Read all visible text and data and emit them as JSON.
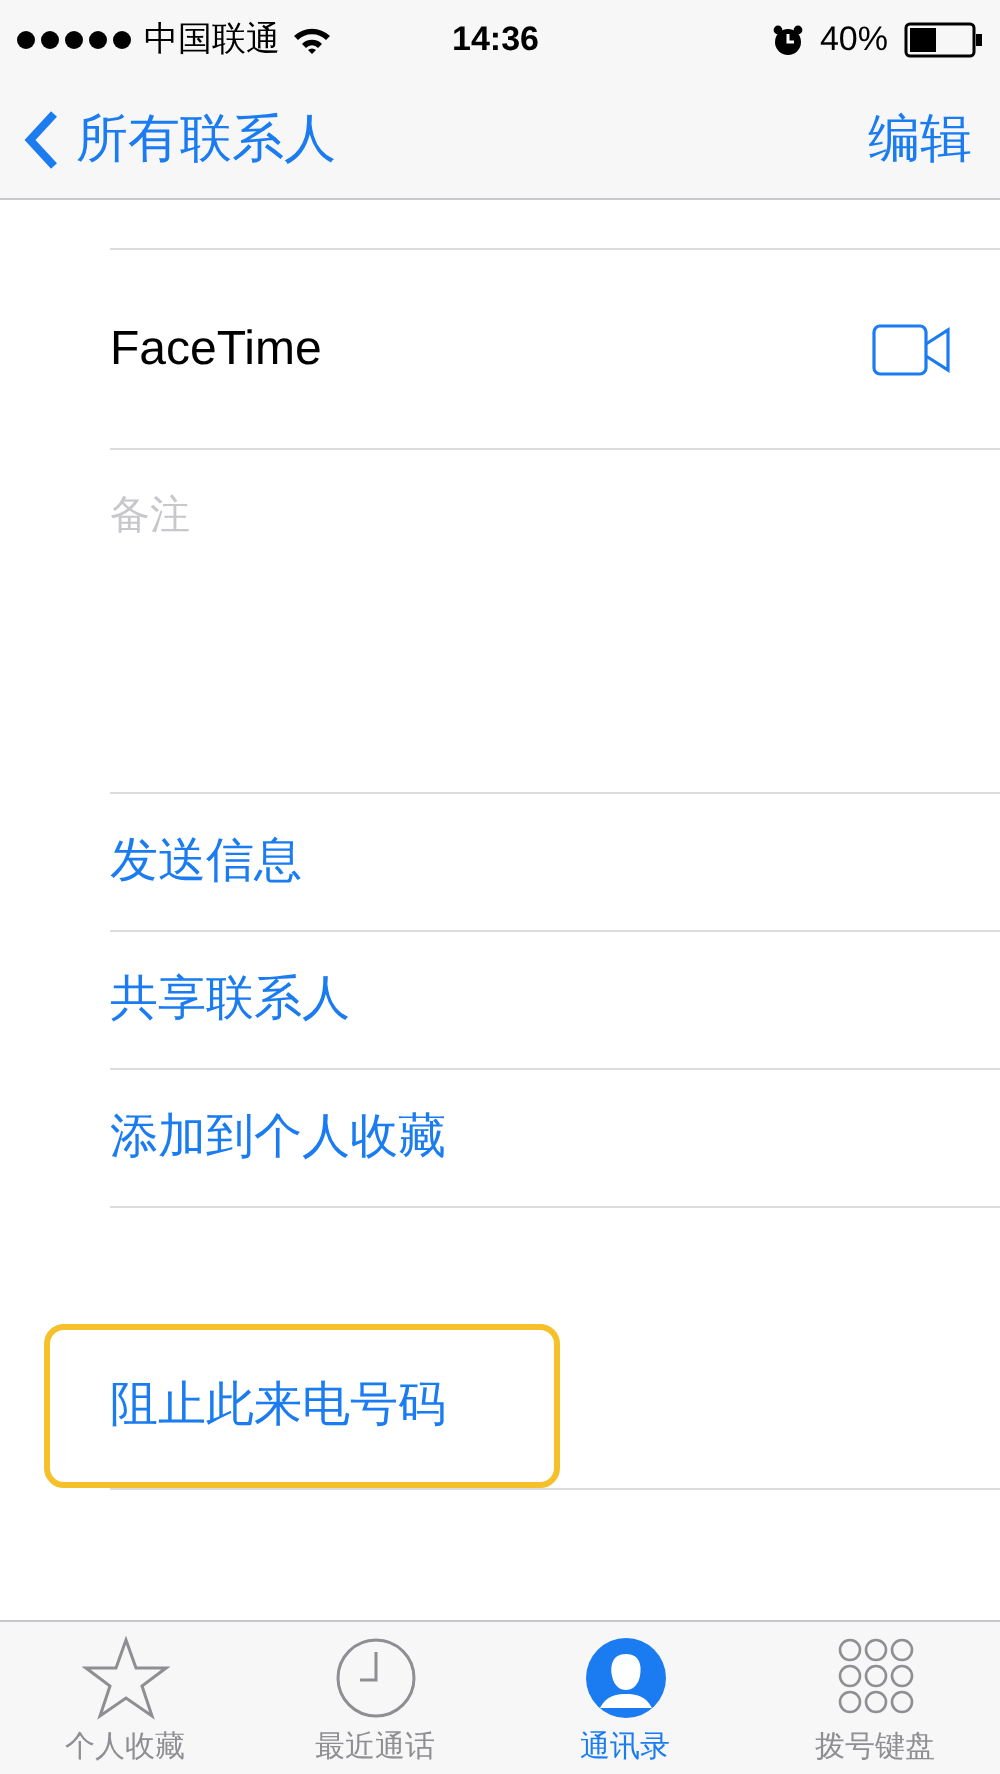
{
  "status_bar": {
    "carrier": "中国联通",
    "time": "14:36",
    "battery": "40%"
  },
  "nav": {
    "back": "所有联系人",
    "action": "编辑"
  },
  "facetime": {
    "label": "FaceTime"
  },
  "notes": {
    "label": "备注"
  },
  "actions": [
    {
      "label": "发送信息"
    },
    {
      "label": "共享联系人"
    },
    {
      "label": "添加到个人收藏"
    }
  ],
  "block": {
    "label": "阻止此来电号码",
    "highlighted": true
  },
  "tabs": [
    {
      "label": "个人收藏",
      "kind": "star",
      "selected": false
    },
    {
      "label": "最近通话",
      "kind": "clock",
      "selected": false
    },
    {
      "label": "通讯录",
      "kind": "person",
      "selected": true
    },
    {
      "label": "拨号键盘",
      "kind": "keypad",
      "selected": false
    }
  ]
}
